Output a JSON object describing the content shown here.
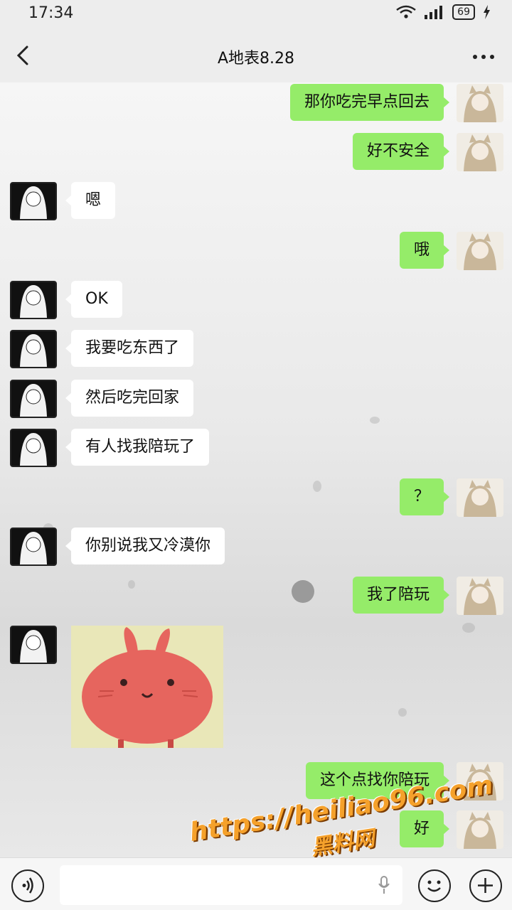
{
  "status_bar": {
    "time": "17:34",
    "battery": "69"
  },
  "header": {
    "title": "A地表8.28"
  },
  "messages": [
    {
      "side": "me",
      "text": "那你吃完早点回去"
    },
    {
      "side": "me",
      "text": "好不安全"
    },
    {
      "side": "other",
      "text": "嗯"
    },
    {
      "side": "me",
      "text": "哦"
    },
    {
      "side": "other",
      "text": "OK"
    },
    {
      "side": "other",
      "text": "我要吃东西了"
    },
    {
      "side": "other",
      "text": "然后吃完回家"
    },
    {
      "side": "other",
      "text": "有人找我陪玩了"
    },
    {
      "side": "me",
      "text": "？"
    },
    {
      "side": "other",
      "text": "你别说我又冷漠你"
    },
    {
      "side": "me",
      "text": "我了陪玩"
    },
    {
      "side": "other",
      "type": "sticker",
      "sticker": "pink-bunny-sticker"
    },
    {
      "side": "me",
      "text": "这个点找你陪玩"
    },
    {
      "side": "me",
      "text": "好"
    }
  ],
  "watermark": {
    "url": "https://heiliao96.com",
    "site_name": "黑料网"
  },
  "colors": {
    "me_bubble": "#95ec69",
    "other_bubble": "#ffffff",
    "watermark": "#f5a12b"
  }
}
